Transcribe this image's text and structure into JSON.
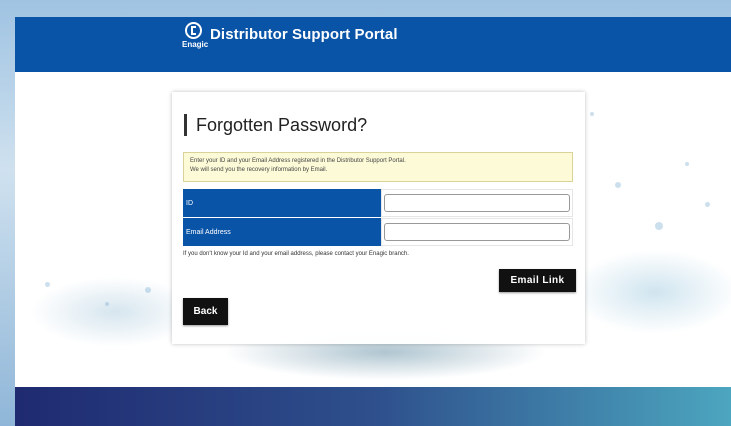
{
  "header": {
    "logo_text": "Enagic",
    "title": "Distributor Support Portal"
  },
  "form_card": {
    "title": "Forgotten Password?",
    "notice_line1": "Enter your ID and your Email Address registered in the Distributor Support Portal.",
    "notice_line2": "We will send you the recovery information by Email.",
    "fields": [
      {
        "label": "ID",
        "value": "",
        "placeholder": ""
      },
      {
        "label": "Email Address",
        "value": "",
        "placeholder": ""
      }
    ],
    "hint": "If you don't know your Id and your email address, please contact your Enagic branch.",
    "email_link_label": "Email Link",
    "back_label": "Back"
  },
  "colors": {
    "header": "#0a54a8",
    "label_bg": "#0a54a8",
    "notice_bg": "#fdfbd7",
    "button_bg": "#111111"
  },
  "icons": [
    "enagic-logo-icon"
  ]
}
